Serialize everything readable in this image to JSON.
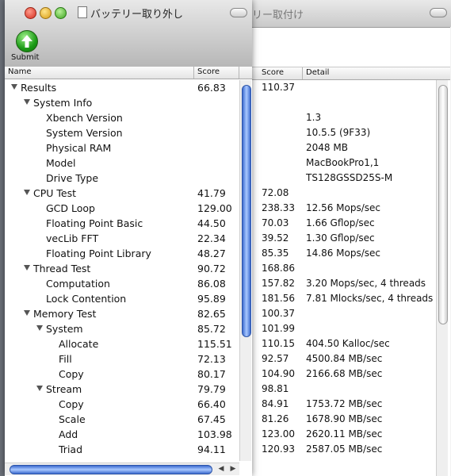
{
  "back_window": {
    "title": "リー取付け",
    "columns": {
      "score": "Score",
      "detail": "Detail"
    },
    "rows": [
      {
        "score": "110.37",
        "detail": ""
      },
      {
        "score": "",
        "detail": ""
      },
      {
        "score": "",
        "detail": "1.3"
      },
      {
        "score": "",
        "detail": "10.5.5 (9F33)"
      },
      {
        "score": "",
        "detail": "2048 MB"
      },
      {
        "score": "",
        "detail": "MacBookPro1,1"
      },
      {
        "score": "",
        "detail": "TS128GSSD25S-M"
      },
      {
        "score": "72.08",
        "detail": ""
      },
      {
        "score": "238.33",
        "detail": "12.56 Mops/sec"
      },
      {
        "score": "70.03",
        "detail": "1.66 Gflop/sec"
      },
      {
        "score": "39.52",
        "detail": "1.30 Gflop/sec"
      },
      {
        "score": "85.35",
        "detail": "14.86 Mops/sec"
      },
      {
        "score": "168.86",
        "detail": ""
      },
      {
        "score": "157.82",
        "detail": "3.20 Mops/sec, 4 threads"
      },
      {
        "score": "181.56",
        "detail": "7.81 Mlocks/sec, 4 threads"
      },
      {
        "score": "100.37",
        "detail": ""
      },
      {
        "score": "101.99",
        "detail": ""
      },
      {
        "score": "110.15",
        "detail": "404.50 Kalloc/sec"
      },
      {
        "score": "92.57",
        "detail": "4500.84 MB/sec"
      },
      {
        "score": "104.90",
        "detail": "2166.68 MB/sec"
      },
      {
        "score": "98.81",
        "detail": ""
      },
      {
        "score": "84.91",
        "detail": "1753.72 MB/sec"
      },
      {
        "score": "81.26",
        "detail": "1678.90 MB/sec"
      },
      {
        "score": "123.00",
        "detail": "2620.11 MB/sec"
      },
      {
        "score": "120.93",
        "detail": "2587.05 MB/sec"
      }
    ]
  },
  "front_window": {
    "title": "バッテリー取り外し",
    "toolbar": {
      "submit_label": "Submit"
    },
    "columns": {
      "name": "Name",
      "score": "Score"
    },
    "rows": [
      {
        "name": "Results",
        "score": "66.83",
        "level": 0,
        "expanded": true
      },
      {
        "name": "System Info",
        "score": "",
        "level": 1,
        "expanded": true
      },
      {
        "name": "Xbench Version",
        "score": "",
        "level": 2
      },
      {
        "name": "System Version",
        "score": "",
        "level": 2
      },
      {
        "name": "Physical RAM",
        "score": "",
        "level": 2
      },
      {
        "name": "Model",
        "score": "",
        "level": 2
      },
      {
        "name": "Drive Type",
        "score": "",
        "level": 2
      },
      {
        "name": "CPU Test",
        "score": "41.79",
        "level": 1,
        "expanded": true
      },
      {
        "name": "GCD Loop",
        "score": "129.00",
        "level": 2
      },
      {
        "name": "Floating Point Basic",
        "score": "44.50",
        "level": 2
      },
      {
        "name": "vecLib FFT",
        "score": "22.34",
        "level": 2
      },
      {
        "name": "Floating Point Library",
        "score": "48.27",
        "level": 2
      },
      {
        "name": "Thread Test",
        "score": "90.72",
        "level": 1,
        "expanded": true
      },
      {
        "name": "Computation",
        "score": "86.08",
        "level": 2
      },
      {
        "name": "Lock Contention",
        "score": "95.89",
        "level": 2
      },
      {
        "name": "Memory Test",
        "score": "82.65",
        "level": 1,
        "expanded": true
      },
      {
        "name": "System",
        "score": "85.72",
        "level": 2,
        "expanded": true
      },
      {
        "name": "Allocate",
        "score": "115.51",
        "level": 3
      },
      {
        "name": "Fill",
        "score": "72.13",
        "level": 3
      },
      {
        "name": "Copy",
        "score": "80.17",
        "level": 3
      },
      {
        "name": "Stream",
        "score": "79.79",
        "level": 2,
        "expanded": true
      },
      {
        "name": "Copy",
        "score": "66.40",
        "level": 3
      },
      {
        "name": "Scale",
        "score": "67.45",
        "level": 3
      },
      {
        "name": "Add",
        "score": "103.98",
        "level": 3
      },
      {
        "name": "Triad",
        "score": "94.11",
        "level": 3
      }
    ]
  },
  "colors": {
    "scroll_accent": "#3c6bd0",
    "submit_green": "#1c9b16"
  }
}
